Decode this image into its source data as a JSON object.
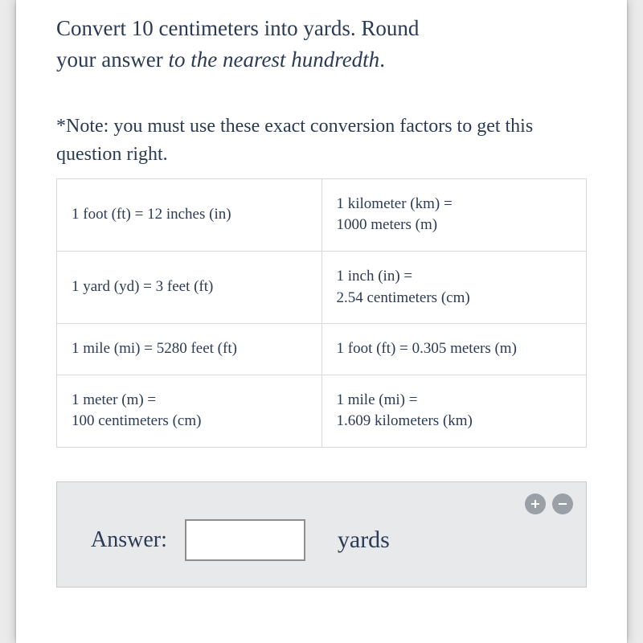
{
  "question": {
    "line1": "Convert 10 centimeters into yards. Round",
    "line2a": "your answer ",
    "line2b": "to the nearest hundredth",
    "line2c": "."
  },
  "note": "*Note: you must use these exact conversion factors to get this question right.",
  "conversions": {
    "r0c0": "1 foot (ft) = 12 inches (in)",
    "r0c1a": "1 kilometer (km) =",
    "r0c1b": "1000 meters (m)",
    "r1c0": "1 yard (yd) = 3 feet (ft)",
    "r1c1a": "1 inch (in) =",
    "r1c1b": "2.54 centimeters (cm)",
    "r2c0": "1 mile (mi) = 5280 feet (ft)",
    "r2c1": "1 foot (ft) = 0.305 meters (m)",
    "r3c0a": "1 meter (m) =",
    "r3c0b": "100 centimeters (cm)",
    "r3c1a": "1 mile (mi) =",
    "r3c1b": "1.609 kilometers (km)"
  },
  "answer": {
    "label": "Answer:",
    "unit": "yards",
    "value": ""
  }
}
